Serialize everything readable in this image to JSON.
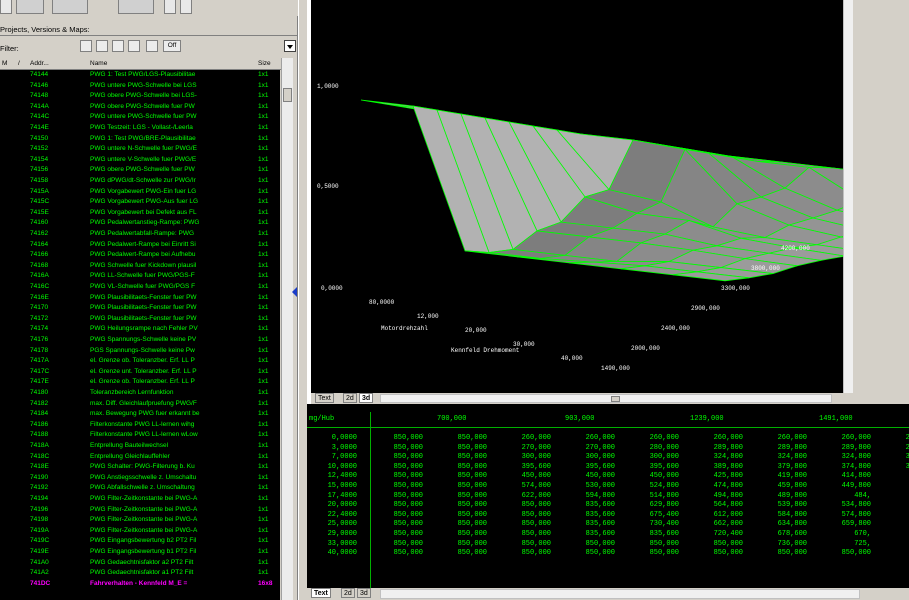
{
  "left_panel": {
    "section_label": "Projects, Versions & Maps:",
    "filter_label": "Filter:",
    "filter_off_label": "Off",
    "columns": {
      "mode": "M",
      "sort": "/",
      "address": "Addr...",
      "name": "Name",
      "size": "Size"
    },
    "rows": [
      {
        "addr": "74144",
        "name": "PWG 1: Test PWG/LGS-Plausibilitae",
        "size": "1x1"
      },
      {
        "addr": "74146",
        "name": "PWG untere PWG-Schwelle bei LGS",
        "size": "1x1"
      },
      {
        "addr": "74148",
        "name": "PWG obere PWG-Schwelle bei LGS-",
        "size": "1x1"
      },
      {
        "addr": "7414A",
        "name": "PWG obere PWG-Schwelle fuer PW",
        "size": "1x1"
      },
      {
        "addr": "7414C",
        "name": "PWG untere PWG-Schwelle fuer PW",
        "size": "1x1"
      },
      {
        "addr": "7414E",
        "name": "PWG Testzeit: LGS - Vollast-/Leerla",
        "size": "1x1"
      },
      {
        "addr": "74150",
        "name": "PWG 1: Test PWG/BRE-Plausibilitae",
        "size": "1x1"
      },
      {
        "addr": "74152",
        "name": "PWG untere N-Schwelle fuer PWG/E",
        "size": "1x1"
      },
      {
        "addr": "74154",
        "name": "PWG untere V-Schwelle fuer PWG/E",
        "size": "1x1"
      },
      {
        "addr": "74156",
        "name": "PWG obere PWG-Schwelle fuer PW",
        "size": "1x1"
      },
      {
        "addr": "74158",
        "name": "PWG dPWG/dt-Schwelle zur PWG/Ir",
        "size": "1x1"
      },
      {
        "addr": "7415A",
        "name": "PWG Vorgabewert PWG-Ein fuer LG",
        "size": "1x1"
      },
      {
        "addr": "7415C",
        "name": "PWG Vorgabewert PWG-Aus fuer LG",
        "size": "1x1"
      },
      {
        "addr": "7415E",
        "name": "PWG Vorgabewert bei Defekt aus FL",
        "size": "1x1"
      },
      {
        "addr": "74160",
        "name": "PWG Pedalwertanstieg-Rampe: PWG",
        "size": "1x1"
      },
      {
        "addr": "74162",
        "name": "PWG Pedalwertabfall-Rampe: PWG",
        "size": "1x1"
      },
      {
        "addr": "74164",
        "name": "PWG Pedalwert-Rampe bei Einritt Si",
        "size": "1x1"
      },
      {
        "addr": "74166",
        "name": "PWG Pedalwert-Rampe bei Aufhebu",
        "size": "1x1"
      },
      {
        "addr": "74168",
        "name": "PWG Schwelle fuer Kickdown plausil",
        "size": "1x1"
      },
      {
        "addr": "7416A",
        "name": "PWG  LL-Schwelle fuer PWG/PGS-F",
        "size": "1x1"
      },
      {
        "addr": "7416C",
        "name": "PWG  VL-Schwelle fuer PWG/PGS F",
        "size": "1x1"
      },
      {
        "addr": "7416E",
        "name": "PWG  Plausibilitaets-Fenster fuer PW",
        "size": "1x1"
      },
      {
        "addr": "74170",
        "name": "PWG  Plausibilitaets-Fenster fuer PW",
        "size": "1x1"
      },
      {
        "addr": "74172",
        "name": "PWG  Plausibilitaets-Fenster fuer PW",
        "size": "1x1"
      },
      {
        "addr": "74174",
        "name": "PWG  Heilungsrampe nach Fehler PV",
        "size": "1x1"
      },
      {
        "addr": "74176",
        "name": "PWG  Spannungs-Schwelle keine PV",
        "size": "1x1"
      },
      {
        "addr": "74178",
        "name": "PGS  Spannungs-Schwelle keine Pw",
        "size": "1x1"
      },
      {
        "addr": "7417A",
        "name": "el. Grenze ob.  Toleranzber. Erf. LL P",
        "size": "1x1"
      },
      {
        "addr": "7417C",
        "name": "el. Grenze unt.  Toleranzber. Erf. LL P",
        "size": "1x1"
      },
      {
        "addr": "7417E",
        "name": "el. Grenze ob.  Toleranzber. Erf. LL P",
        "size": "1x1"
      },
      {
        "addr": "74180",
        "name": "Toleranzbereich Lernfunktion",
        "size": "1x1"
      },
      {
        "addr": "74182",
        "name": "max. Diff. Gleichlaufpruefung PWG/F",
        "size": "1x1"
      },
      {
        "addr": "74184",
        "name": "max. Bewegung PWG fuer erkannt be",
        "size": "1x1"
      },
      {
        "addr": "74186",
        "name": "Filterkonstante PWG LL-lernen wihg",
        "size": "1x1"
      },
      {
        "addr": "74188",
        "name": "Filterkonstante PWG LL-lernen wLow",
        "size": "1x1"
      },
      {
        "addr": "7418A",
        "name": "Entprellung Bauteilwechsel",
        "size": "1x1"
      },
      {
        "addr": "7418C",
        "name": "Entprellung Gleichlauffehler",
        "size": "1x1"
      },
      {
        "addr": "7418E",
        "name": "PWG Schalter: PWG-Filterung b. Ku",
        "size": "1x1"
      },
      {
        "addr": "74190",
        "name": "PWG Anstiegsschwelle z. Umschaltu",
        "size": "1x1"
      },
      {
        "addr": "74192",
        "name": "PWG Abfallschwelle z. Umschaltung",
        "size": "1x1"
      },
      {
        "addr": "74194",
        "name": "PWG Filter-Zeitkonstante bei PWG-A",
        "size": "1x1"
      },
      {
        "addr": "74196",
        "name": "PWG Filter-Zeitkonstante bei PWG-A",
        "size": "1x1"
      },
      {
        "addr": "74198",
        "name": "PWG Filter-Zeitkonstante bei PWG-A",
        "size": "1x1"
      },
      {
        "addr": "7419A",
        "name": "PWG Filter-Zeitkonstante bei PWG-A",
        "size": "1x1"
      },
      {
        "addr": "7419C",
        "name": "PWG Eingangsbewertung b2 PT2 Fil",
        "size": "1x1"
      },
      {
        "addr": "7419E",
        "name": "PWG Eingangsbewertung b1 PT2 Fil",
        "size": "1x1"
      },
      {
        "addr": "741A0",
        "name": "PWG Gedaechtnisfaktor a2 PT2 Filt",
        "size": "1x1"
      },
      {
        "addr": "741A2",
        "name": "PWG Gedaechtnisfaktor a1 PT2 Filt",
        "size": "1x1"
      }
    ],
    "selected_row": {
      "addr": "741DC",
      "name": "Fahrverhalten - Kennfeld M_E  =",
      "size": "16x8"
    }
  },
  "graph": {
    "z_tick_labels": [
      "1,0000",
      "0,5000"
    ],
    "x_tick_labels": [
      "0,0000",
      "80,0000",
      "12,000",
      "20,000",
      "30,000",
      "40,000"
    ],
    "x_axis_title": "Motordrehzahl",
    "y_tick_labels": [
      "1490,000",
      "2000,000",
      "2400,000",
      "2900,000",
      "3300,000",
      "3800,000",
      "4200,000"
    ],
    "y_axis_title": "Kennfeld Drehmoment",
    "tabs": [
      "Text",
      "2d",
      "3d"
    ],
    "active_tab": "3d"
  },
  "table": {
    "corner_label": "mg/Hub",
    "column_headers": [
      "700,000",
      "903,000",
      "1239,000",
      "1491,000"
    ],
    "rows": [
      {
        "label": "0,0000",
        "values": [
          "850,000",
          "850,000",
          "260,000",
          "260,000",
          "260,000",
          "260,000",
          "260,000",
          "260,000",
          "260,000",
          "260,"
        ]
      },
      {
        "label": "3,0000",
        "values": [
          "850,000",
          "850,000",
          "270,000",
          "270,000",
          "280,000",
          "289,800",
          "289,800",
          "289,800",
          "289,800",
          "289,"
        ]
      },
      {
        "label": "7,0000",
        "values": [
          "850,000",
          "850,000",
          "300,000",
          "300,000",
          "300,000",
          "324,800",
          "324,800",
          "324,800",
          "324,800",
          "324,"
        ]
      },
      {
        "label": "10,0000",
        "values": [
          "850,000",
          "850,000",
          "395,600",
          "395,600",
          "395,600",
          "389,800",
          "379,800",
          "374,800",
          "374,800",
          "374,"
        ]
      },
      {
        "label": "12,4000",
        "values": [
          "850,000",
          "850,000",
          "450,000",
          "450,000",
          "450,000",
          "425,800",
          "419,800",
          "414,800",
          "409,"
        ]
      },
      {
        "label": "15,0000",
        "values": [
          "850,000",
          "850,000",
          "574,000",
          "530,000",
          "524,800",
          "474,800",
          "459,800",
          "449,800",
          "444,"
        ]
      },
      {
        "label": "17,4000",
        "values": [
          "850,000",
          "850,000",
          "622,000",
          "594,800",
          "514,800",
          "494,800",
          "489,800",
          "484,"
        ]
      },
      {
        "label": "20,0000",
        "values": [
          "850,000",
          "850,000",
          "850,000",
          "835,600",
          "629,800",
          "564,800",
          "539,800",
          "534,800",
          "529,"
        ]
      },
      {
        "label": "22,4000",
        "values": [
          "850,000",
          "850,000",
          "850,000",
          "835,600",
          "675,400",
          "612,000",
          "584,800",
          "574,800",
          "569,"
        ]
      },
      {
        "label": "25,0000",
        "values": [
          "850,000",
          "850,000",
          "850,000",
          "835,600",
          "730,400",
          "662,000",
          "634,800",
          "659,800",
          "614,"
        ]
      },
      {
        "label": "29,0000",
        "values": [
          "850,000",
          "850,000",
          "850,000",
          "835,600",
          "835,600",
          "720,400",
          "678,600",
          "670,"
        ]
      },
      {
        "label": "33,0000",
        "values": [
          "850,000",
          "850,000",
          "850,000",
          "850,000",
          "850,000",
          "850,000",
          "736,000",
          "725,"
        ]
      },
      {
        "label": "40,0000",
        "values": [
          "850,000",
          "850,000",
          "850,000",
          "850,000",
          "850,000",
          "850,000",
          "850,000",
          "850,000",
          "850,"
        ]
      }
    ],
    "tabs": [
      "Text",
      "2d",
      "3d"
    ],
    "active_tab": "Text"
  },
  "colors": {
    "list_text": "#00ff00",
    "selected_text": "#ff00ff",
    "surface_grid": "#00ff00"
  }
}
